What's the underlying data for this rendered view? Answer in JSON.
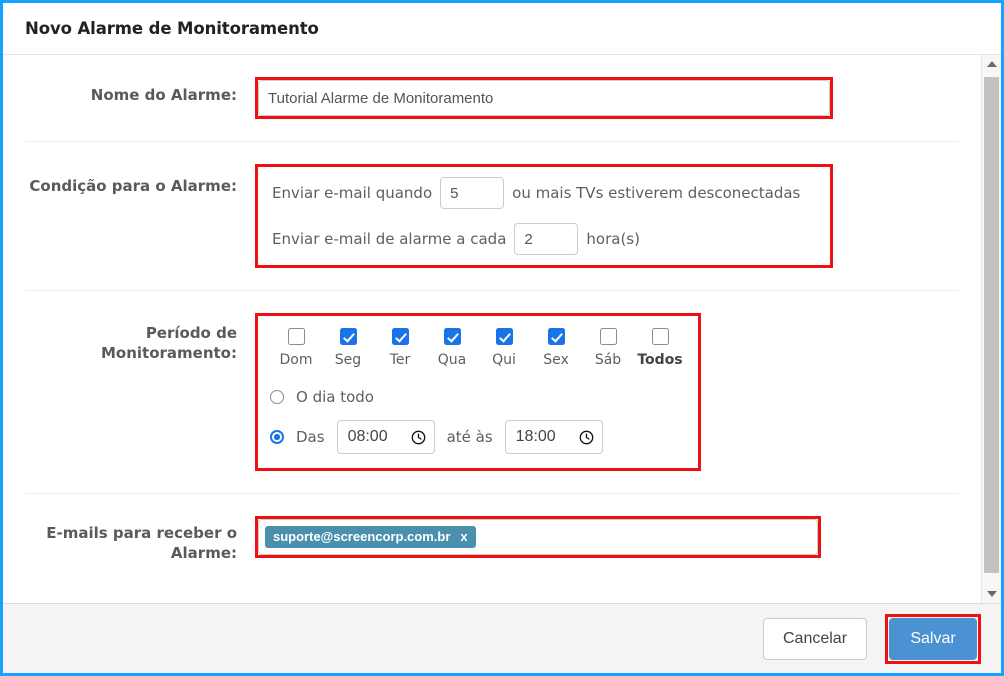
{
  "dialog": {
    "title": "Novo Alarme de Monitoramento"
  },
  "fields": {
    "name": {
      "label": "Nome do Alarme:",
      "value": "Tutorial Alarme de Monitoramento"
    },
    "condition": {
      "label": "Condição para o Alarme:",
      "line1_before": "Enviar e-mail quando",
      "line1_value": "5",
      "line1_after": "ou mais TVs estiverem desconectadas",
      "line2_before": "Enviar e-mail de alarme a cada",
      "line2_value": "2",
      "line2_after": "hora(s)"
    },
    "period": {
      "label_line1": "Período de",
      "label_line2": "Monitoramento:",
      "days": [
        {
          "label": "Dom",
          "checked": false,
          "strong": false
        },
        {
          "label": "Seg",
          "checked": true,
          "strong": false
        },
        {
          "label": "Ter",
          "checked": true,
          "strong": false
        },
        {
          "label": "Qua",
          "checked": true,
          "strong": false
        },
        {
          "label": "Qui",
          "checked": true,
          "strong": false
        },
        {
          "label": "Sex",
          "checked": true,
          "strong": false
        },
        {
          "label": "Sáb",
          "checked": false,
          "strong": false
        },
        {
          "label": "Todos",
          "checked": false,
          "strong": true
        }
      ],
      "all_day_label": "O dia todo",
      "all_day_selected": false,
      "range_label": "Das",
      "range_selected": true,
      "start_time": "08:00",
      "between_label": "até às",
      "end_time": "18:00",
      "clock_icon": "clock-icon"
    },
    "emails": {
      "label_line1": "E-mails para receber o",
      "label_line2": "Alarme:",
      "tags": [
        {
          "text": "suporte@screencorp.com.br",
          "remove": "x"
        }
      ]
    }
  },
  "footer": {
    "cancel_label": "Cancelar",
    "save_label": "Salvar"
  },
  "scrollbar": {
    "up_icon": "arrow-up-icon",
    "down_icon": "arrow-down-icon"
  },
  "colors": {
    "window_border": "#17a2ff",
    "highlight": "#ee1111",
    "primary": "#4a92d2",
    "checkbox_checked": "#1a73e8",
    "tag": "#4a90ad"
  }
}
